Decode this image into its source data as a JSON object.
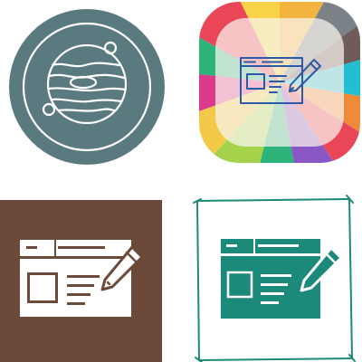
{
  "icons": [
    {
      "id": "planet",
      "colors": {
        "background": "#5b7a7f",
        "line": "#ffffff"
      }
    },
    {
      "id": "web-edit-colorful",
      "colors": {
        "segments": [
          "#f8d348",
          "#ef8a3a",
          "#e94758",
          "#dc3c8b",
          "#a5d24b",
          "#2eb37a",
          "#2f8fd8",
          "#23bfd0",
          "#8a58c6",
          "#b36a4c",
          "#6c8a8c",
          "#7a8187"
        ],
        "center": "#fbf5f0",
        "line": "#2b5aa8",
        "pencil": "#2b5aa8"
      }
    },
    {
      "id": "web-edit-solid",
      "colors": {
        "background": "#6b4a3a",
        "glyph": "#ffffff"
      }
    },
    {
      "id": "web-edit-teal",
      "colors": {
        "frame": "#1b8a7b",
        "glyph": "#1b8a7b",
        "background": "#ffffff"
      }
    }
  ]
}
